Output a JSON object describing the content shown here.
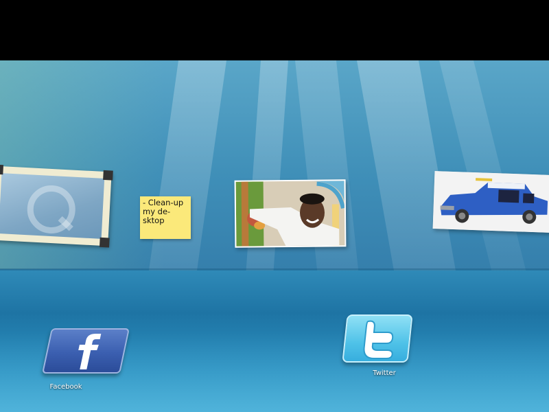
{
  "sticky_note": {
    "text": "- Clean-up my de-sktop"
  },
  "desktop_icons": {
    "facebook": {
      "label": "Facebook",
      "icon": "facebook-icon",
      "color": "#3b5fb0"
    },
    "twitter": {
      "label": "Twitter",
      "icon": "twitter-icon",
      "color": "#4fc2e8"
    }
  },
  "wall_items": {
    "frame": {
      "icon": "q-logo-icon"
    },
    "photo": {
      "icon": "person-photo"
    },
    "car_photo": {
      "icon": "toy-car-photo"
    }
  },
  "colors": {
    "background": "#3689b2",
    "note": "#fbe97a"
  }
}
